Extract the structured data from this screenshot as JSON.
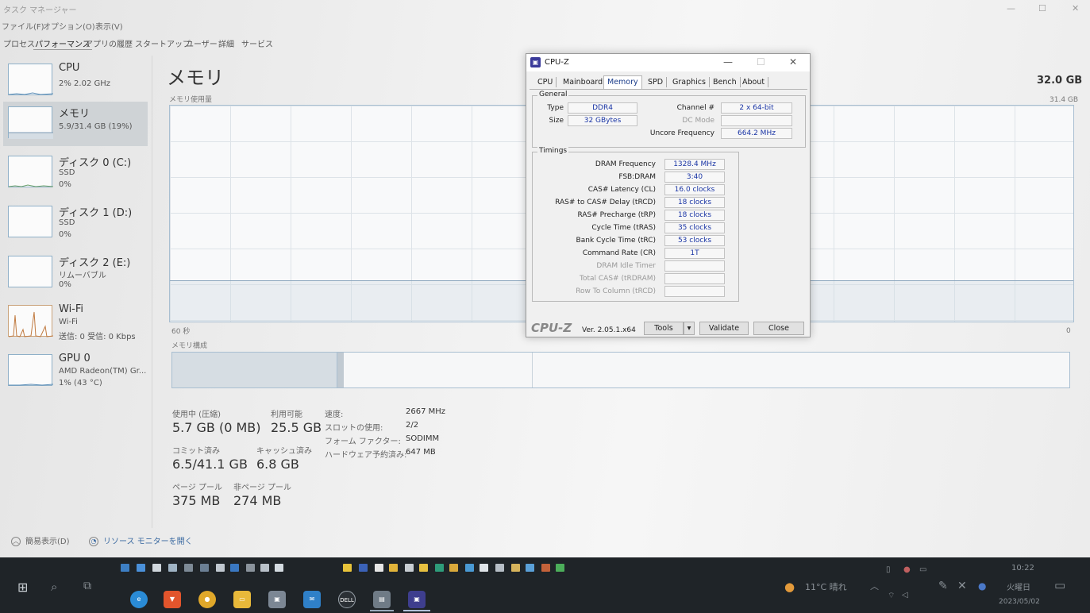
{
  "window": {
    "title": "タスク マネージャー",
    "menu": [
      "ファイル(F)",
      "オプション(O)",
      "表示(V)"
    ],
    "tabs": [
      "プロセス",
      "パフォーマンス",
      "アプリの履歴",
      "スタートアップ",
      "ユーザー",
      "詳細",
      "サービス"
    ],
    "active_tab": "パフォーマンス"
  },
  "sidebar": {
    "items": [
      {
        "name": "CPU",
        "sub1": "2% 2.02 GHz",
        "sub2": ""
      },
      {
        "name": "メモリ",
        "sub1": "5.9/31.4 GB (19%)",
        "sub2": ""
      },
      {
        "name": "ディスク 0 (C:)",
        "sub1": "SSD",
        "sub2": "0%"
      },
      {
        "name": "ディスク 1 (D:)",
        "sub1": "SSD",
        "sub2": "0%"
      },
      {
        "name": "ディスク 2 (E:)",
        "sub1": "リムーバブル",
        "sub2": "0%"
      },
      {
        "name": "Wi-Fi",
        "sub1": "Wi-Fi",
        "sub2": "送信: 0 受信: 0 Kbps"
      },
      {
        "name": "GPU 0",
        "sub1": "AMD Radeon(TM) Gr...",
        "sub2": "1% (43 °C)"
      }
    ]
  },
  "main": {
    "title": "メモリ",
    "total": "32.0 GB",
    "graph_label": "メモリ使用量",
    "graph_max": "31.4 GB",
    "graph_time": "60 秒",
    "graph_min": "0",
    "composition_label": "メモリ構成",
    "usage_fraction": 0.19,
    "stats": {
      "in_use_label": "使用中 (圧縮)",
      "in_use": "5.7 GB (0 MB)",
      "available_label": "利用可能",
      "available": "25.5 GB",
      "committed_label": "コミット済み",
      "committed": "6.5/41.1 GB",
      "cached_label": "キャッシュ済み",
      "cached": "6.8 GB",
      "paged_label": "ページ プール",
      "paged": "375 MB",
      "nonpaged_label": "非ページ プール",
      "nonpaged": "274 MB"
    },
    "specs": [
      {
        "label": "速度:",
        "value": "2667 MHz"
      },
      {
        "label": "スロットの使用:",
        "value": "2/2"
      },
      {
        "label": "フォーム ファクター:",
        "value": "SODIMM"
      },
      {
        "label": "ハードウェア予約済み:",
        "value": "647 MB"
      }
    ]
  },
  "footer": {
    "fewer_details": "簡易表示(D)",
    "resource_monitor": "リソース モニターを開く"
  },
  "cpuz": {
    "title": "CPU-Z",
    "tabs": [
      "CPU",
      "Mainboard",
      "Memory",
      "SPD",
      "Graphics",
      "Bench",
      "About"
    ],
    "active_tab": "Memory",
    "general_title": "General",
    "type_label": "Type",
    "type": "DDR4",
    "size_label": "Size",
    "size": "32 GBytes",
    "channel_label": "Channel #",
    "channel": "2 x 64-bit",
    "dcmode_label": "DC Mode",
    "dcmode": "",
    "uncore_label": "Uncore Frequency",
    "uncore": "664.2 MHz",
    "timings_title": "Timings",
    "timings": [
      {
        "label": "DRAM Frequency",
        "value": "1328.4 MHz",
        "dim": false
      },
      {
        "label": "FSB:DRAM",
        "value": "3:40",
        "dim": false
      },
      {
        "label": "CAS# Latency (CL)",
        "value": "16.0 clocks",
        "dim": false
      },
      {
        "label": "RAS# to CAS# Delay (tRCD)",
        "value": "18 clocks",
        "dim": false
      },
      {
        "label": "RAS# Precharge (tRP)",
        "value": "18 clocks",
        "dim": false
      },
      {
        "label": "Cycle Time (tRAS)",
        "value": "35 clocks",
        "dim": false
      },
      {
        "label": "Bank Cycle Time (tRC)",
        "value": "53 clocks",
        "dim": false
      },
      {
        "label": "Command Rate (CR)",
        "value": "1T",
        "dim": false
      },
      {
        "label": "DRAM Idle Timer",
        "value": "",
        "dim": true
      },
      {
        "label": "Total CAS# (tRDRAM)",
        "value": "",
        "dim": true
      },
      {
        "label": "Row To Column (tRCD)",
        "value": "",
        "dim": true
      }
    ],
    "brand": "CPU-Z",
    "version": "Ver. 2.05.1.x64",
    "tools_label": "Tools",
    "validate_label": "Validate",
    "close_label": "Close"
  },
  "taskbar": {
    "weather": "11°C 晴れ",
    "time": "10:22",
    "day": "火曜日",
    "date": "2023/05/02",
    "dell_label": "DELL"
  }
}
